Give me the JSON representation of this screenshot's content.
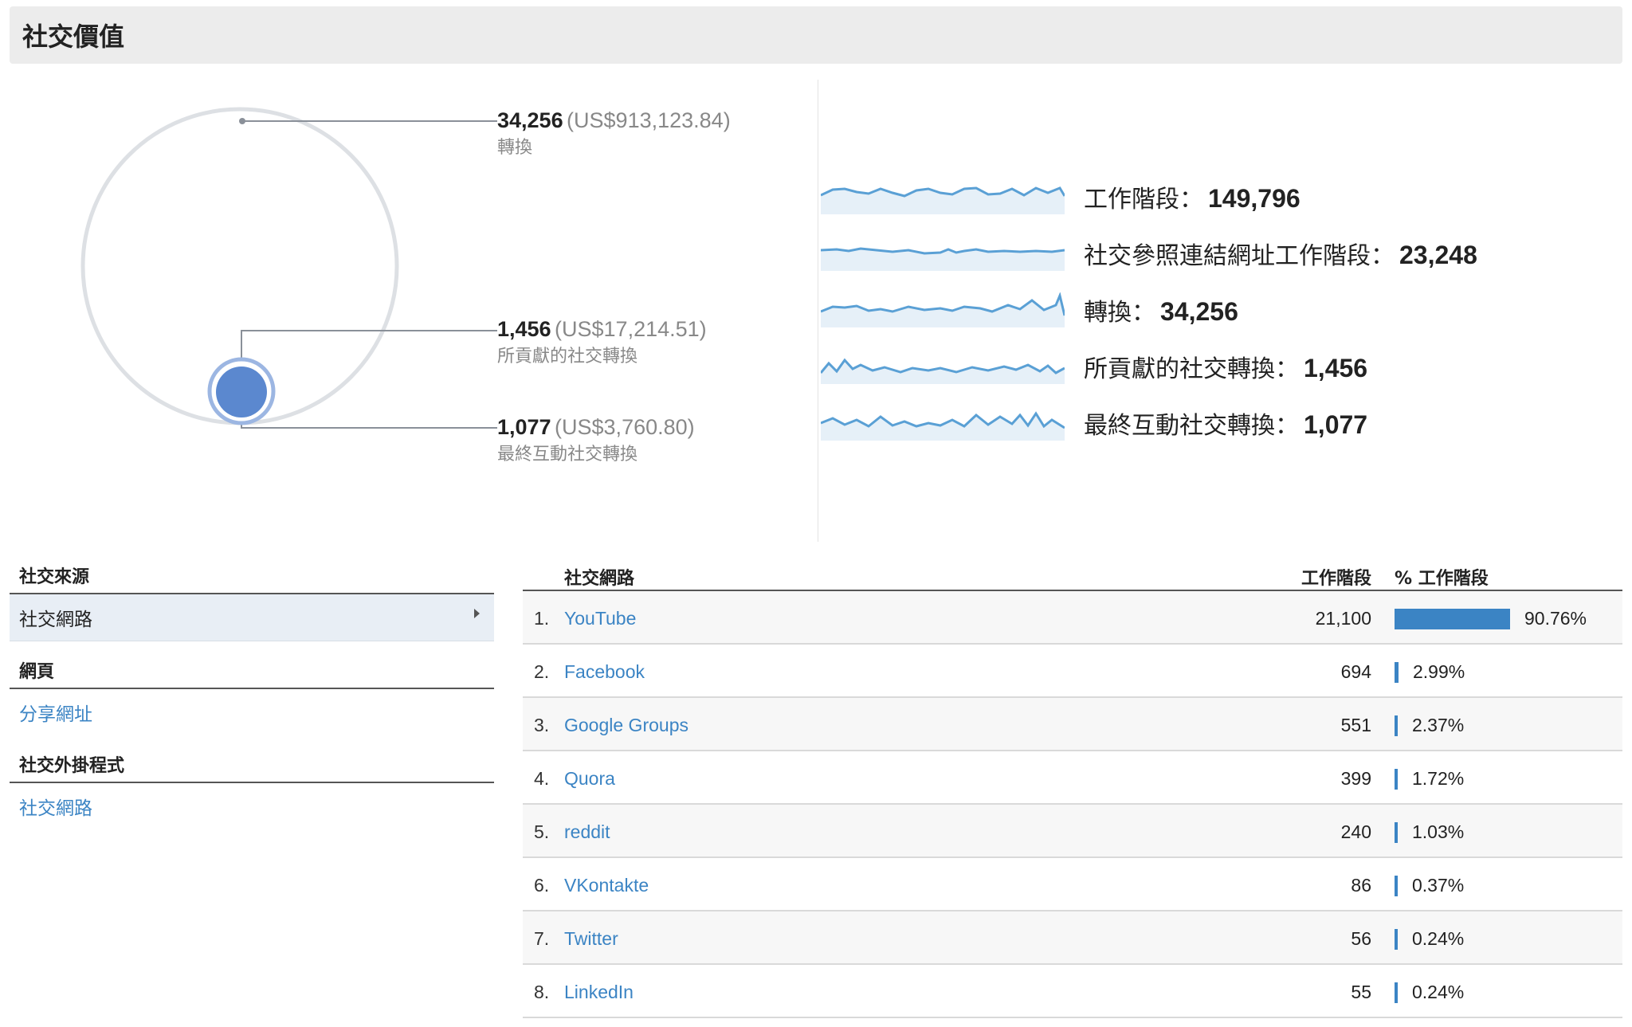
{
  "header": {
    "title": "社交價值"
  },
  "overview": {
    "callouts": [
      {
        "number": "34,256",
        "money": "(US$913,123.84)",
        "label": "轉換"
      },
      {
        "number": "1,456",
        "money": "(US$17,214.51)",
        "label": "所貢獻的社交轉換"
      },
      {
        "number": "1,077",
        "money": "(US$3,760.80)",
        "label": "最終互動社交轉換"
      }
    ]
  },
  "metrics": [
    {
      "label": "工作階段：",
      "value": "149,796"
    },
    {
      "label": "社交參照連結網址工作階段：",
      "value": "23,248"
    },
    {
      "label": "轉換：",
      "value": "34,256"
    },
    {
      "label": "所貢獻的社交轉換：",
      "value": "1,456"
    },
    {
      "label": "最終互動社交轉換：",
      "value": "1,077"
    }
  ],
  "nav": {
    "groups": [
      {
        "heading": "社交來源",
        "items": [
          {
            "label": "社交網路",
            "selected": true
          }
        ]
      },
      {
        "heading": "網頁",
        "items": [
          {
            "label": "分享網址",
            "selected": false
          }
        ]
      },
      {
        "heading": "社交外掛程式",
        "items": [
          {
            "label": "社交網路",
            "selected": false
          }
        ]
      }
    ]
  },
  "table": {
    "headers": {
      "network": "社交網路",
      "sessions": "工作階段",
      "pct": "% 工作階段"
    },
    "rows": [
      {
        "idx": "1.",
        "name": "YouTube",
        "sessions": "21,100",
        "pct": "90.76%",
        "share": 0.9076
      },
      {
        "idx": "2.",
        "name": "Facebook",
        "sessions": "694",
        "pct": "2.99%",
        "share": 0.0299
      },
      {
        "idx": "3.",
        "name": "Google Groups",
        "sessions": "551",
        "pct": "2.37%",
        "share": 0.0237
      },
      {
        "idx": "4.",
        "name": "Quora",
        "sessions": "399",
        "pct": "1.72%",
        "share": 0.0172
      },
      {
        "idx": "5.",
        "name": "reddit",
        "sessions": "240",
        "pct": "1.03%",
        "share": 0.0103
      },
      {
        "idx": "6.",
        "name": "VKontakte",
        "sessions": "86",
        "pct": "0.37%",
        "share": 0.0037
      },
      {
        "idx": "7.",
        "name": "Twitter",
        "sessions": "56",
        "pct": "0.24%",
        "share": 0.0024
      },
      {
        "idx": "8.",
        "name": "LinkedIn",
        "sessions": "55",
        "pct": "0.24%",
        "share": 0.0024
      }
    ]
  },
  "colors": {
    "accent": "#3b84c4",
    "circle": "#dde0e4",
    "dot": "#5b88cf",
    "spark": "#5aa0d5",
    "sparkFill": "#e6f0f8"
  }
}
